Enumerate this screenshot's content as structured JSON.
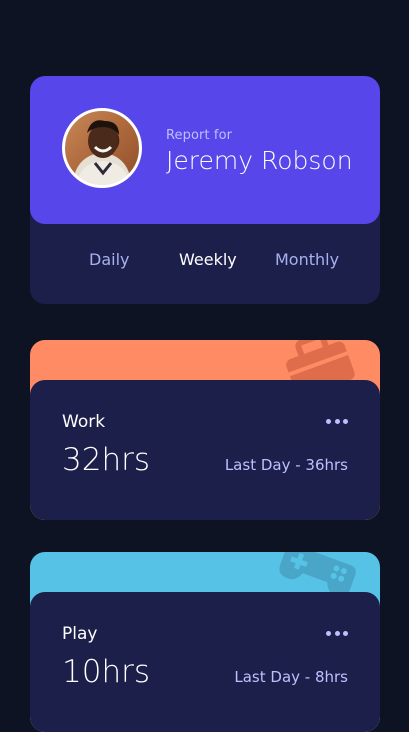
{
  "profile": {
    "report_for": "Report for",
    "name": "Jeremy Robson"
  },
  "tabs": [
    {
      "label": "Daily",
      "active": false
    },
    {
      "label": "Weekly",
      "active": true
    },
    {
      "label": "Monthly",
      "active": false
    }
  ],
  "activities": [
    {
      "title": "Work",
      "hours": "32hrs",
      "last": "Last Day - 36hrs",
      "color": "#ff8b64",
      "icon": "briefcase-icon"
    },
    {
      "title": "Play",
      "hours": "10hrs",
      "last": "Last Day - 8hrs",
      "color": "#55c2e6",
      "icon": "gamepad-icon"
    }
  ],
  "colors": {
    "background": "#0e1323",
    "card": "#1c1f4a",
    "accent": "#5747ea",
    "pale_text": "#bbc0ff"
  }
}
